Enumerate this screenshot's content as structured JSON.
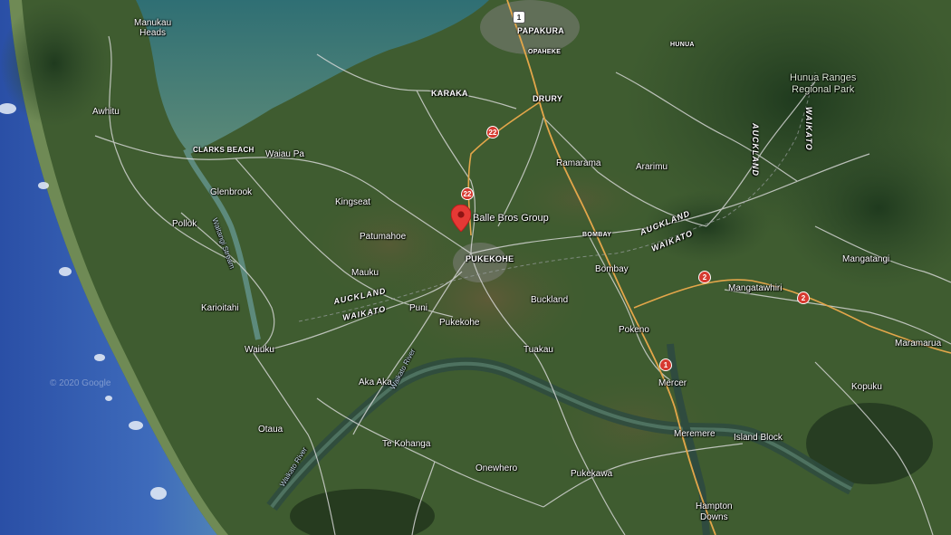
{
  "map": {
    "poi": {
      "name": "Balle Bros Group",
      "marker": "map-pin-icon",
      "color": "#e53935"
    },
    "towns": {
      "papakura": "PAPAKURA",
      "opaheke": "OPAHEKE",
      "hunua": "HUNUA",
      "karaka": "KARAKA",
      "drury": "DRURY",
      "clarks_beach": "CLARKS BEACH",
      "pukekohe_upper": "PUKEKOHE",
      "bombay_upper": "BOMBAY"
    },
    "places": {
      "manukau_heads": "Manukau\nHeads",
      "awhitu": "Awhitu",
      "waiau_pa": "Waiau Pa",
      "glenbrook": "Glenbrook",
      "pollok": "Pollok",
      "kingseat": "Kingseat",
      "patumahoe": "Patumahoe",
      "mauku": "Mauku",
      "karioitahi": "Karioitahi",
      "puni": "Puni",
      "pukekohe": "Pukekohe",
      "waiuku": "Waiuku",
      "ramarama": "Ramarama",
      "ararimu": "Ararimu",
      "bombay": "Bombay",
      "buckland": "Buckland",
      "tuakau": "Tuakau",
      "pokeno": "Pokeno",
      "mangatawhiri": "Mangatawhiri",
      "mangatangi": "Mangatangi",
      "maramarua": "Maramarua",
      "mercer": "Mercer",
      "kopuku": "Kopuku",
      "aka_aka": "Aka Aka",
      "otaua": "Otaua",
      "te_kohanga": "Te Kohanga",
      "onewhero": "Onewhero",
      "pukekawa": "Pukekawa",
      "meremere": "Meremere",
      "island_block": "Island Block",
      "hampton_downs": "Hampton\nDowns"
    },
    "park": "Hunua Ranges\nRegional Park",
    "regions": {
      "auckland_1": "AUCKLAND",
      "waikato_1": "WAIKATO",
      "auckland_2": "AUCKLAND",
      "waikato_2": "WAIKATO",
      "auckland_3": "AUCKLAND",
      "waikato_3": "WAIKATO"
    },
    "rivers": {
      "waikato_1": "Waikato River",
      "waikato_2": "Waikato River",
      "waitangi": "Waitangi Stream"
    },
    "shields": {
      "s1_top": "1",
      "s22_a": "22",
      "s22_b": "22",
      "s2_a": "2",
      "s2_b": "2",
      "s1_b": "1"
    },
    "watermark": "© 2020 Google",
    "colors": {
      "ocean": "#2f55a8",
      "land": "#3d5a2e",
      "harbour": "#3f7f80",
      "road": "#e8e8e8",
      "highway": "#e3a64a",
      "pin": "#e53935"
    }
  }
}
